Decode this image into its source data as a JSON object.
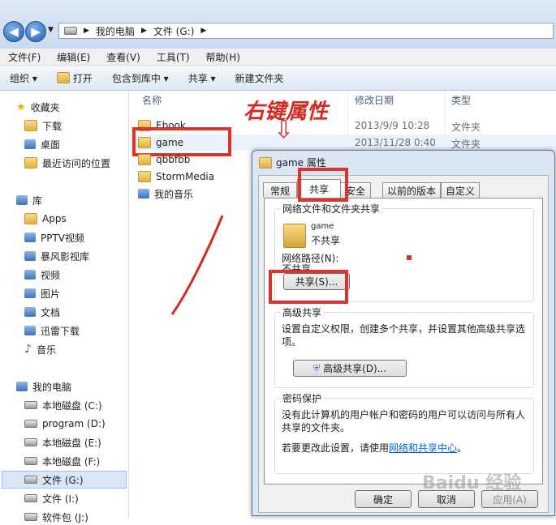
{
  "address": {
    "back": "◀",
    "fwd": "▶",
    "crumbs": [
      "我的电脑",
      "文件 (G:)"
    ]
  },
  "menu": [
    "文件(F)",
    "编辑(E)",
    "查看(V)",
    "工具(T)",
    "帮助(H)"
  ],
  "toolbar": [
    "组织 ▾",
    "打开",
    "包含到库中 ▾",
    "共享 ▾",
    "新建文件夹"
  ],
  "nav": {
    "favorites": "收藏夹",
    "fav_items": [
      "下载",
      "桌面",
      "最近访问的位置"
    ],
    "libraries": "库",
    "lib_items": [
      "Apps",
      "PPTV视频",
      "暴风影视库",
      "视频",
      "图片",
      "文档",
      "迅雷下载",
      "音乐"
    ],
    "computer": "我的电脑",
    "drives": [
      "本地磁盘 (C:)",
      "program (D:)",
      "本地磁盘 (E:)",
      "本地磁盘 (F:)",
      "文件 (G:)",
      "文件 (I:)",
      "软件包 (J:)"
    ]
  },
  "columns": {
    "name": "名称",
    "date": "修改日期",
    "type": "类型"
  },
  "files": [
    {
      "name": "Ebook",
      "date": "2013/9/9 10:28",
      "type": "文件夹"
    },
    {
      "name": "game",
      "date": "2013/11/28 0:40",
      "type": "文件夹"
    },
    {
      "name": "qbbfbb",
      "date": "",
      "type": ""
    },
    {
      "name": "StormMedia",
      "date": "",
      "type": ""
    },
    {
      "name": "我的音乐",
      "date": "",
      "type": ""
    }
  ],
  "annotation": "右键属性",
  "dialog": {
    "title": "game 属性",
    "tabs": [
      "常规",
      "共享",
      "安全",
      "以前的版本",
      "自定义"
    ],
    "net_section": "网络文件和文件夹共享",
    "folder_name": "game",
    "folder_status": "不共享",
    "net_path_label": "网络路径(N):",
    "net_path_value": "不共享",
    "share_button": "共享(S)...",
    "adv_section": "高级共享",
    "adv_desc": "设置自定义权限，创建多个共享，并设置其他高级共享选项。",
    "adv_button": "高级共享(D)...",
    "pwd_section": "密码保护",
    "pwd_desc": "没有此计算机的用户帐户和密码的用户可以访问与所有人共享的文件夹。",
    "pwd_change_prefix": "若要更改此设置，请使用",
    "pwd_link": "网络和共享中心",
    "pwd_change_suffix": "。",
    "ok": "确定",
    "cancel": "取消",
    "apply": "应用(A)"
  },
  "watermark": "Baidu 经验"
}
